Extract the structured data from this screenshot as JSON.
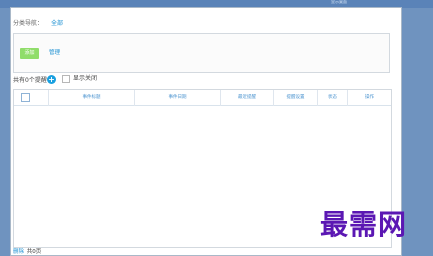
{
  "topbar": {
    "right_text": "显示桌面"
  },
  "category": {
    "label": "分类导航：",
    "value": "全部"
  },
  "filter": {
    "add_label": "添加",
    "manage_label": "管理"
  },
  "count": {
    "text": "共有0个提醒",
    "show_closed_label": "显示关闭"
  },
  "table": {
    "columns": [
      "事件标题",
      "事件日期",
      "最近提醒",
      "提醒设置",
      "状态",
      "操作"
    ]
  },
  "footer": {
    "delete_label": "删除",
    "pages_text": "共0页"
  },
  "watermark": {
    "text": "最需网"
  }
}
